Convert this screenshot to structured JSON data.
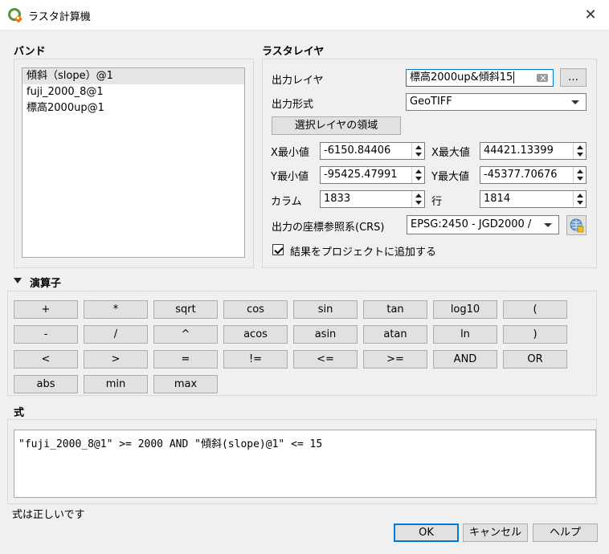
{
  "window": {
    "title": "ラスタ計算機",
    "close_glyph": "✕"
  },
  "bands": {
    "header": "バンド",
    "items": [
      "傾斜（slope）@1",
      "fuji_2000_8@1",
      "標高2000up@1"
    ]
  },
  "raster_layer": {
    "header": "ラスタレイヤ",
    "output_layer_label": "出力レイヤ",
    "output_layer_value": "標高2000up&傾斜15",
    "browse_label": "…",
    "output_format_label": "出力形式",
    "output_format_value": "GeoTIFF",
    "extent_button": "選択レイヤの領域",
    "xmin_label": "X最小値",
    "xmin_value": "-6150.84406",
    "xmax_label": "X最大値",
    "xmax_value": "44421.13399",
    "ymin_label": "Y最小値",
    "ymin_value": "-95425.47991",
    "ymax_label": "Y最大値",
    "ymax_value": "-45377.70676",
    "columns_label": "カラム",
    "columns_value": "1833",
    "rows_label": "行",
    "rows_value": "1814",
    "crs_label": "出力の座標参照系(CRS)",
    "crs_value": "EPSG:2450 - JGD2000 /",
    "add_to_project_label": "結果をプロジェクトに追加する",
    "add_to_project_checked": true
  },
  "operators": {
    "header": "演算子",
    "buttons": [
      "+",
      "*",
      "sqrt",
      "cos",
      "sin",
      "tan",
      "log10",
      "(",
      "-",
      "/",
      "^",
      "acos",
      "asin",
      "atan",
      "ln",
      ")",
      "<",
      ">",
      "=",
      "!=",
      "<=",
      ">=",
      "AND",
      "OR",
      "abs",
      "min",
      "max"
    ]
  },
  "expression": {
    "header": "式",
    "value": "\"fuji_2000_8@1\" >= 2000 AND \"傾斜(slope)@1\" <= 15",
    "status": "式は正しいです"
  },
  "footer": {
    "ok": "OK",
    "cancel": "キャンセル",
    "help": "ヘルプ"
  },
  "colors": {
    "accent": "#0078d7",
    "qgis_green": "#589632",
    "qgis_yellow": "#ee7913"
  }
}
